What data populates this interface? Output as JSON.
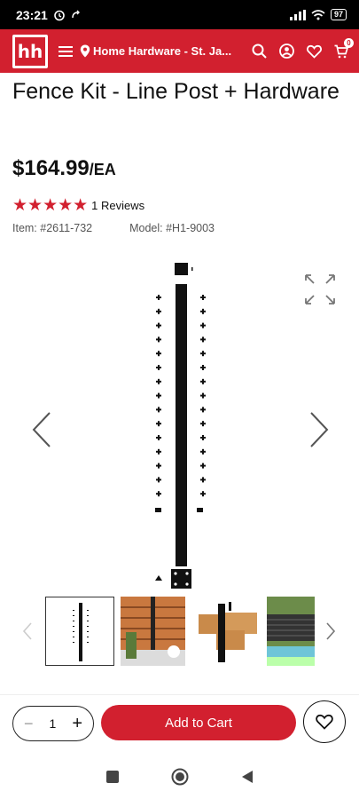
{
  "status": {
    "time": "23:21",
    "battery": "97"
  },
  "header": {
    "store_name": "Home Hardware - St. Ja...",
    "cart_count": "0",
    "logo_text": "hh"
  },
  "product": {
    "title": "Fence Kit - Line Post + Hardware",
    "price": "$164.99",
    "unit": "/EA",
    "stars": "★★★★★",
    "rating_value": 5,
    "reviews": "1 Reviews",
    "item": "Item: #2611-732",
    "model": "Model: #H1-9003"
  },
  "actions": {
    "quantity": "1",
    "minus": "−",
    "plus": "+",
    "add_to_cart": "Add to Cart"
  },
  "colors": {
    "brand_red": "#d2202f"
  },
  "icons": [
    "menu-icon",
    "location-pin-icon",
    "search-icon",
    "account-icon",
    "heart-icon",
    "cart-icon",
    "expand-icon",
    "chevron-left-icon",
    "chevron-right-icon",
    "stop-icon",
    "home-icon",
    "back-icon"
  ]
}
